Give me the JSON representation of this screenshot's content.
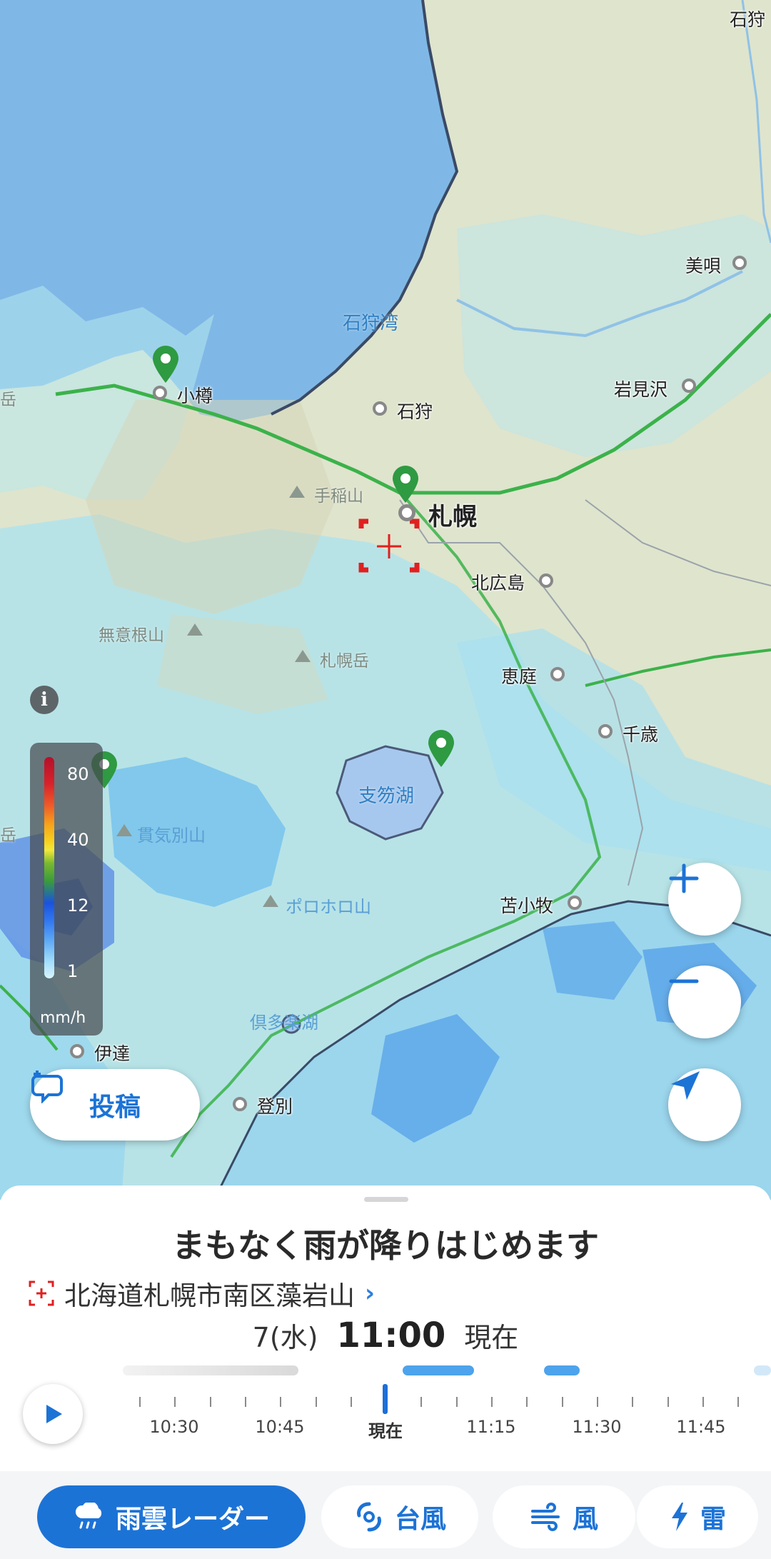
{
  "map": {
    "places": {
      "ishikari_top": "石狩",
      "bibai": "美唄",
      "ishikari_bay": "石狩湾",
      "otaru": "小樽",
      "ishikari": "石狩",
      "iwamizawa": "岩見沢",
      "teine": "手稲山",
      "sapporo": "札幌",
      "kitahiroshima": "北広島",
      "muine": "無意根山",
      "sapporodake": "札幌岳",
      "eniwa": "恵庭",
      "chitose": "千歳",
      "shikotsu": "支笏湖",
      "kimobetsu": "貫気別山",
      "tomakomai": "苫小牧",
      "horohoro": "ポロホロ山",
      "kuttara": "倶多楽湖",
      "date": "伊達",
      "noboribetsu": "登別",
      "edge_left": "岳",
      "edge_left2": "岳"
    },
    "legend": {
      "levels": [
        "80",
        "40",
        "12",
        "1"
      ],
      "unit": "mm/h"
    },
    "post_button": "投稿",
    "info_label": "i"
  },
  "sheet": {
    "headline": "まもなく雨が降りはじめます",
    "location": "北海道札幌市南区藻岩山",
    "date": "7(水)",
    "time": "11:00",
    "now_label": "現在",
    "timeline": [
      "10:30",
      "10:45",
      "現在",
      "11:15",
      "11:30",
      "11:45"
    ]
  },
  "nav": {
    "items": [
      "雨雲レーダー",
      "台風",
      "風",
      "雷"
    ],
    "active": "雨雲レーダー"
  },
  "colors": {
    "accent": "#1c73d6",
    "sea": "#86bfe8",
    "land": "#dfe6cf",
    "rain_light": "#a8e6ef",
    "rail": "#3bb24a"
  }
}
